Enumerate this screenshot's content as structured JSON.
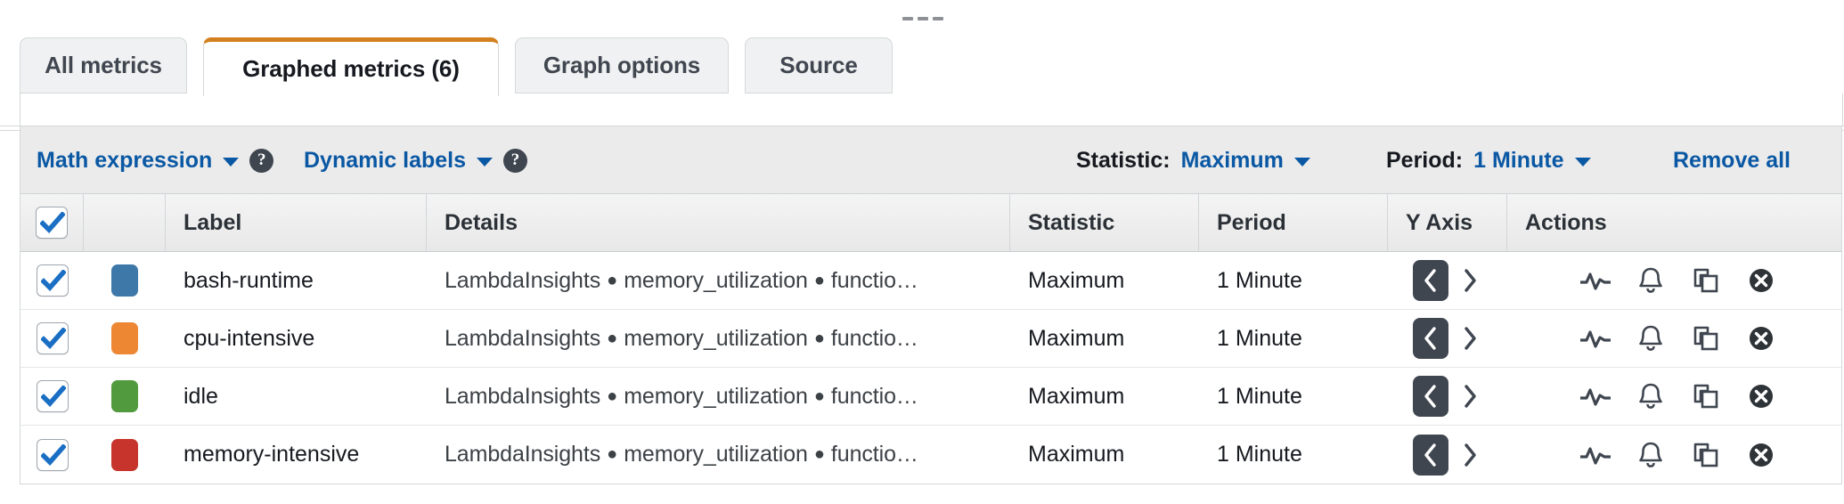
{
  "panel": {
    "drag_handle_icon": "drag-dots-horizontal-icon"
  },
  "tabs": [
    {
      "label": "All metrics",
      "active": false
    },
    {
      "label": "Graphed metrics (6)",
      "active": true
    },
    {
      "label": "Graph options",
      "active": false
    },
    {
      "label": "Source",
      "active": false
    }
  ],
  "toolbar": {
    "math_expression_label": "Math expression",
    "math_expression_caret_icon": "chevron-down-icon",
    "math_expression_help_icon": "help-circle-icon",
    "math_expression_help_glyph": "?",
    "dynamic_labels_label": "Dynamic labels",
    "dynamic_labels_caret_icon": "chevron-down-icon",
    "dynamic_labels_help_icon": "help-circle-icon",
    "dynamic_labels_help_glyph": "?",
    "statistic_label": "Statistic:",
    "statistic_value": "Maximum",
    "statistic_caret_icon": "chevron-down-icon",
    "period_label": "Period:",
    "period_value": "1 Minute",
    "period_caret_icon": "chevron-down-icon",
    "remove_all_label": "Remove all"
  },
  "table": {
    "select_all_checked": true,
    "headers": {
      "select_all": "",
      "color": "",
      "label": "Label",
      "details": "Details",
      "statistic": "Statistic",
      "period": "Period",
      "yaxis": "Y Axis",
      "actions": "Actions"
    },
    "action_icons": [
      "pulse-line-icon",
      "bell-alarm-icon",
      "duplicate-copy-icon",
      "remove-circle-x-icon"
    ],
    "yaxis_icons": {
      "left": "chevron-left-icon",
      "right": "chevron-right-icon"
    },
    "rows": [
      {
        "checked": true,
        "color": "#3d78a8",
        "label": "bash-runtime",
        "details_namespace": "LambdaInsights",
        "details_metric": "memory_utilization",
        "details_dimension": "functio…",
        "statistic": "Maximum",
        "period": "1 Minute",
        "yaxis_selected": "left"
      },
      {
        "checked": true,
        "color": "#ed8733",
        "label": "cpu-intensive",
        "details_namespace": "LambdaInsights",
        "details_metric": "memory_utilization",
        "details_dimension": "functio…",
        "statistic": "Maximum",
        "period": "1 Minute",
        "yaxis_selected": "left"
      },
      {
        "checked": true,
        "color": "#519a3e",
        "label": "idle",
        "details_namespace": "LambdaInsights",
        "details_metric": "memory_utilization",
        "details_dimension": "functio…",
        "statistic": "Maximum",
        "period": "1 Minute",
        "yaxis_selected": "left"
      },
      {
        "checked": true,
        "color": "#c6342c",
        "label": "memory-intensive",
        "details_namespace": "LambdaInsights",
        "details_metric": "memory_utilization",
        "details_dimension": "functio…",
        "statistic": "Maximum",
        "period": "1 Minute",
        "yaxis_selected": "left"
      }
    ]
  },
  "colors": {
    "active_tab_accent": "#d3801f",
    "link": "#0a58a4",
    "toolbar_bg": "#ebebeb",
    "header_text": "#2b3137",
    "selected_toggle_bg": "#3f4650"
  }
}
